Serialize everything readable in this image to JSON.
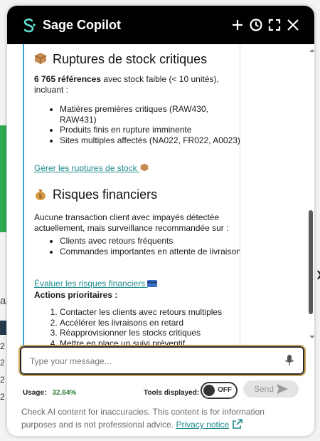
{
  "app": {
    "title": "Sage Copilot",
    "accent": "#3ba3d8",
    "link_color": "#1f8a8a"
  },
  "header_icons": [
    "plus-icon",
    "history-icon",
    "expand-icon",
    "close-icon"
  ],
  "background": {
    "partial_letter": "a",
    "row_numbers": [
      "2",
      "2",
      "2",
      "2"
    ]
  },
  "content": {
    "stock": {
      "emoji": "package-icon",
      "title": "Ruptures de stock critiques",
      "intro_bold": "6 765 références",
      "intro_rest": " avec stock faible (< 10 unités), incluant :",
      "items": [
        "Matières premières critiques (RAW430, RAW431)",
        "Produits finis en rupture imminente",
        "Sites multiples affectés (NA022, FR022, A0023)"
      ],
      "link": "Gérer les ruptures de stock"
    },
    "finance": {
      "emoji": "money-bag-icon",
      "title": "Risques financiers",
      "intro": "Aucune transaction client avec impayés détectée actuellement, mais surveillance recommandée sur :",
      "items": [
        "Clients avec retours fréquents",
        "Commandes importantes en attente de livraison"
      ],
      "link": "Évaluer les risques financiers"
    },
    "actions": {
      "title": "Actions prioritaires :",
      "items": [
        "Contacter les clients avec retours multiples",
        "Accélérer les livraisons en retard",
        "Réapprovisionner les stocks critiques",
        "Mettre en place un suivi préventif"
      ]
    }
  },
  "input": {
    "placeholder": "Type your message..."
  },
  "footer": {
    "usage_label": "Usage:",
    "usage_value": "32.64%",
    "tools_label": "Tools displayed:",
    "toggle_state": "OFF",
    "send_label": "Send",
    "disclaimer": "Check AI content for inaccuracies. This content is for information purposes and is not professional advice.",
    "privacy_link": "Privacy notice"
  }
}
